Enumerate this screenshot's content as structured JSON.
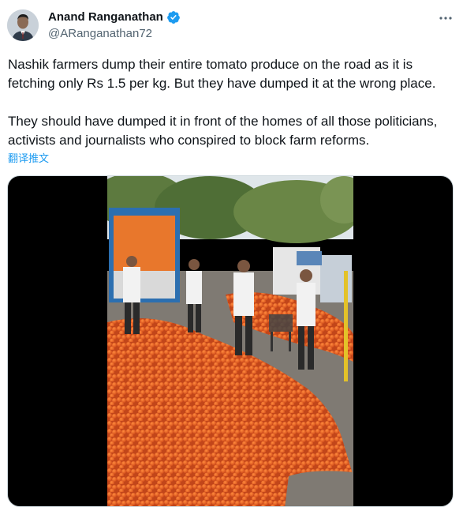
{
  "author": {
    "display_name": "Anand Ranganathan",
    "handle": "@ARanganathan72",
    "verified_icon": "verified-badge-icon",
    "avatar_icon": "avatar-photo"
  },
  "tweet": {
    "paragraphs": [
      "Nashik farmers dump their entire tomato produce on the road as it is fetching only Rs 1.5 per kg. But they have dumped it at the wrong place.",
      "They should have dumped it in front of the homes of all those politicians, activists and journalists who conspired to block farm reforms."
    ],
    "translate_label": "翻译推文"
  },
  "media": {
    "type": "video-thumbnail"
  },
  "colors": {
    "text_primary": "#0f1419",
    "text_secondary": "#536471",
    "link": "#1d9bf0",
    "verified": "#1d9bf0"
  }
}
